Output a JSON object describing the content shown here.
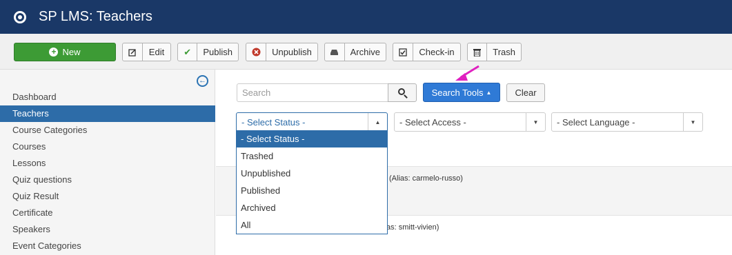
{
  "header": {
    "title": "SP LMS: Teachers"
  },
  "toolbar": {
    "new": "New",
    "edit": "Edit",
    "publish": "Publish",
    "unpublish": "Unpublish",
    "archive": "Archive",
    "checkin": "Check-in",
    "trash": "Trash"
  },
  "sidebar": {
    "items": [
      "Dashboard",
      "Teachers",
      "Course Categories",
      "Courses",
      "Lessons",
      "Quiz questions",
      "Quiz Result",
      "Certificate",
      "Speakers",
      "Event Categories"
    ],
    "active": "Teachers"
  },
  "filters": {
    "search_placeholder": "Search",
    "search_tools": "Search Tools",
    "clear": "Clear",
    "status": "- Select Status -",
    "access": "- Select Access -",
    "language": "- Select Language -"
  },
  "status_dropdown": {
    "options": [
      "- Select Status -",
      "Trashed",
      "Unpublished",
      "Published",
      "Archived",
      "All"
    ],
    "selected": "- Select Status -"
  },
  "rows": {
    "alias1": "(Alias: carmelo-russo)",
    "alias2": "as: smitt-vivien)"
  },
  "colors": {
    "header": "#1a3867",
    "primary": "#2f7ad6",
    "success": "#3d9b35",
    "annotation": "#e020c0"
  },
  "icons": [
    "logo-icon",
    "plus-icon",
    "edit-icon",
    "check-icon",
    "unpublish-icon",
    "archive-icon",
    "checkin-icon",
    "trash-icon",
    "collapse-icon",
    "search-icon",
    "caret-up-icon",
    "caret-down-icon"
  ]
}
